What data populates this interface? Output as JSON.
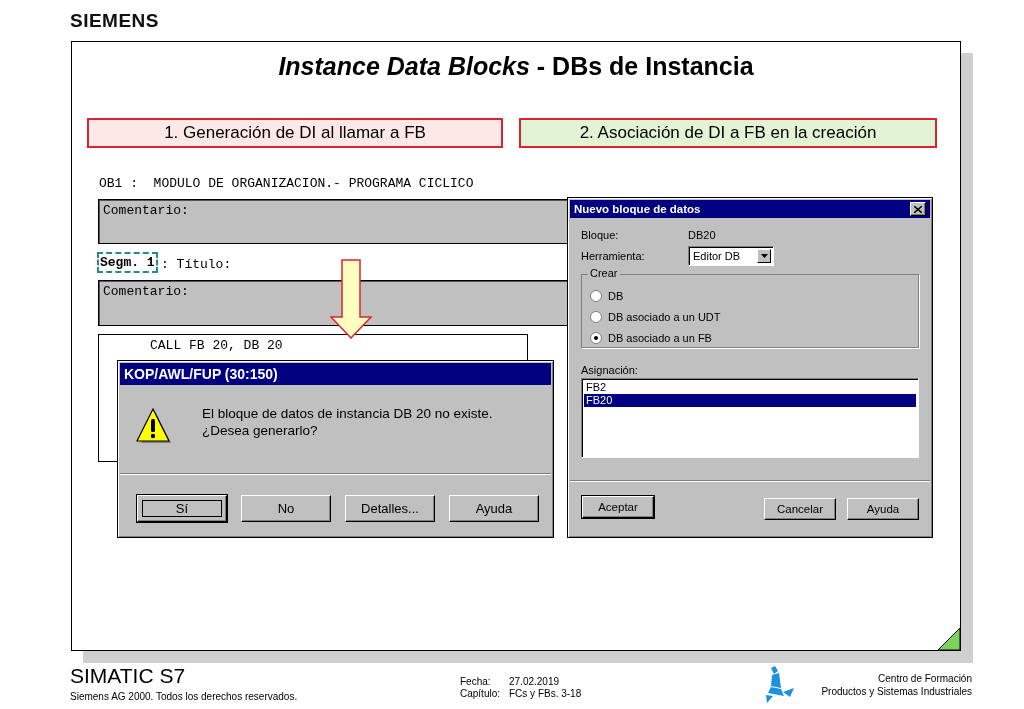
{
  "brand": "SIEMENS",
  "slide": {
    "title": "*Instance Data Blocks* - DBs de Instancia",
    "steps": [
      {
        "label": "1. Generación de DI al llamar a FB",
        "color": "#fde8e8"
      },
      {
        "label": "2. Asociación de DI a FB en la creación",
        "color": "#e2f4d4"
      }
    ],
    "editor": {
      "header": "OB1 :  MODULO DE ORGANIZACION.- PROGRAMA CICLICO",
      "block_comment": "Comentario:",
      "network": "Segm. 1",
      "network_title": ": Título:",
      "network_comment": "Comentario:",
      "code": "CALL FB 20, DB 20"
    },
    "message_dialog": {
      "title": "KOP/AWL/FUP  (30:150)",
      "message": "El bloque de datos de instancia DB 20 no existe. ¿Desea generarlo?",
      "buttons": [
        {
          "label": "Sí",
          "default": true
        },
        {
          "label": "No",
          "default": false
        },
        {
          "label": "Detalles...",
          "default": false
        },
        {
          "label": "Ayuda",
          "default": false
        }
      ]
    },
    "new_block_dialog": {
      "title": "Nuevo bloque de datos",
      "block_label": "Bloque:",
      "block_value": "DB20",
      "tool_label": "Herramienta:",
      "tool_value": "Editor DB",
      "create_group": "Crear",
      "create_options": [
        {
          "label": "DB",
          "selected": false
        },
        {
          "label": "DB asociado a un UDT",
          "selected": false
        },
        {
          "label": "DB asociado a un FB",
          "selected": true
        }
      ],
      "assignment_label": "Asignación:",
      "assignment_items": [
        {
          "label": "FB2",
          "selected": false
        },
        {
          "label": "FB20",
          "selected": true
        }
      ],
      "buttons": [
        {
          "label": "Aceptar",
          "default": true
        },
        {
          "label": "Cancelar",
          "default": false
        },
        {
          "label": "Ayuda",
          "default": false
        }
      ]
    }
  },
  "footer": {
    "product": "SIMATIC S7",
    "copyright": "Siemens AG 2000. Todos los derechos reservados.",
    "date_label": "Fecha:",
    "date": "27.02.2019",
    "chapter_label": "Capítulo:",
    "chapter": "FCs y FBs. 3-18",
    "center_lines": [
      "Centro de Formación",
      "Productos y Sistemas Industriales"
    ]
  }
}
